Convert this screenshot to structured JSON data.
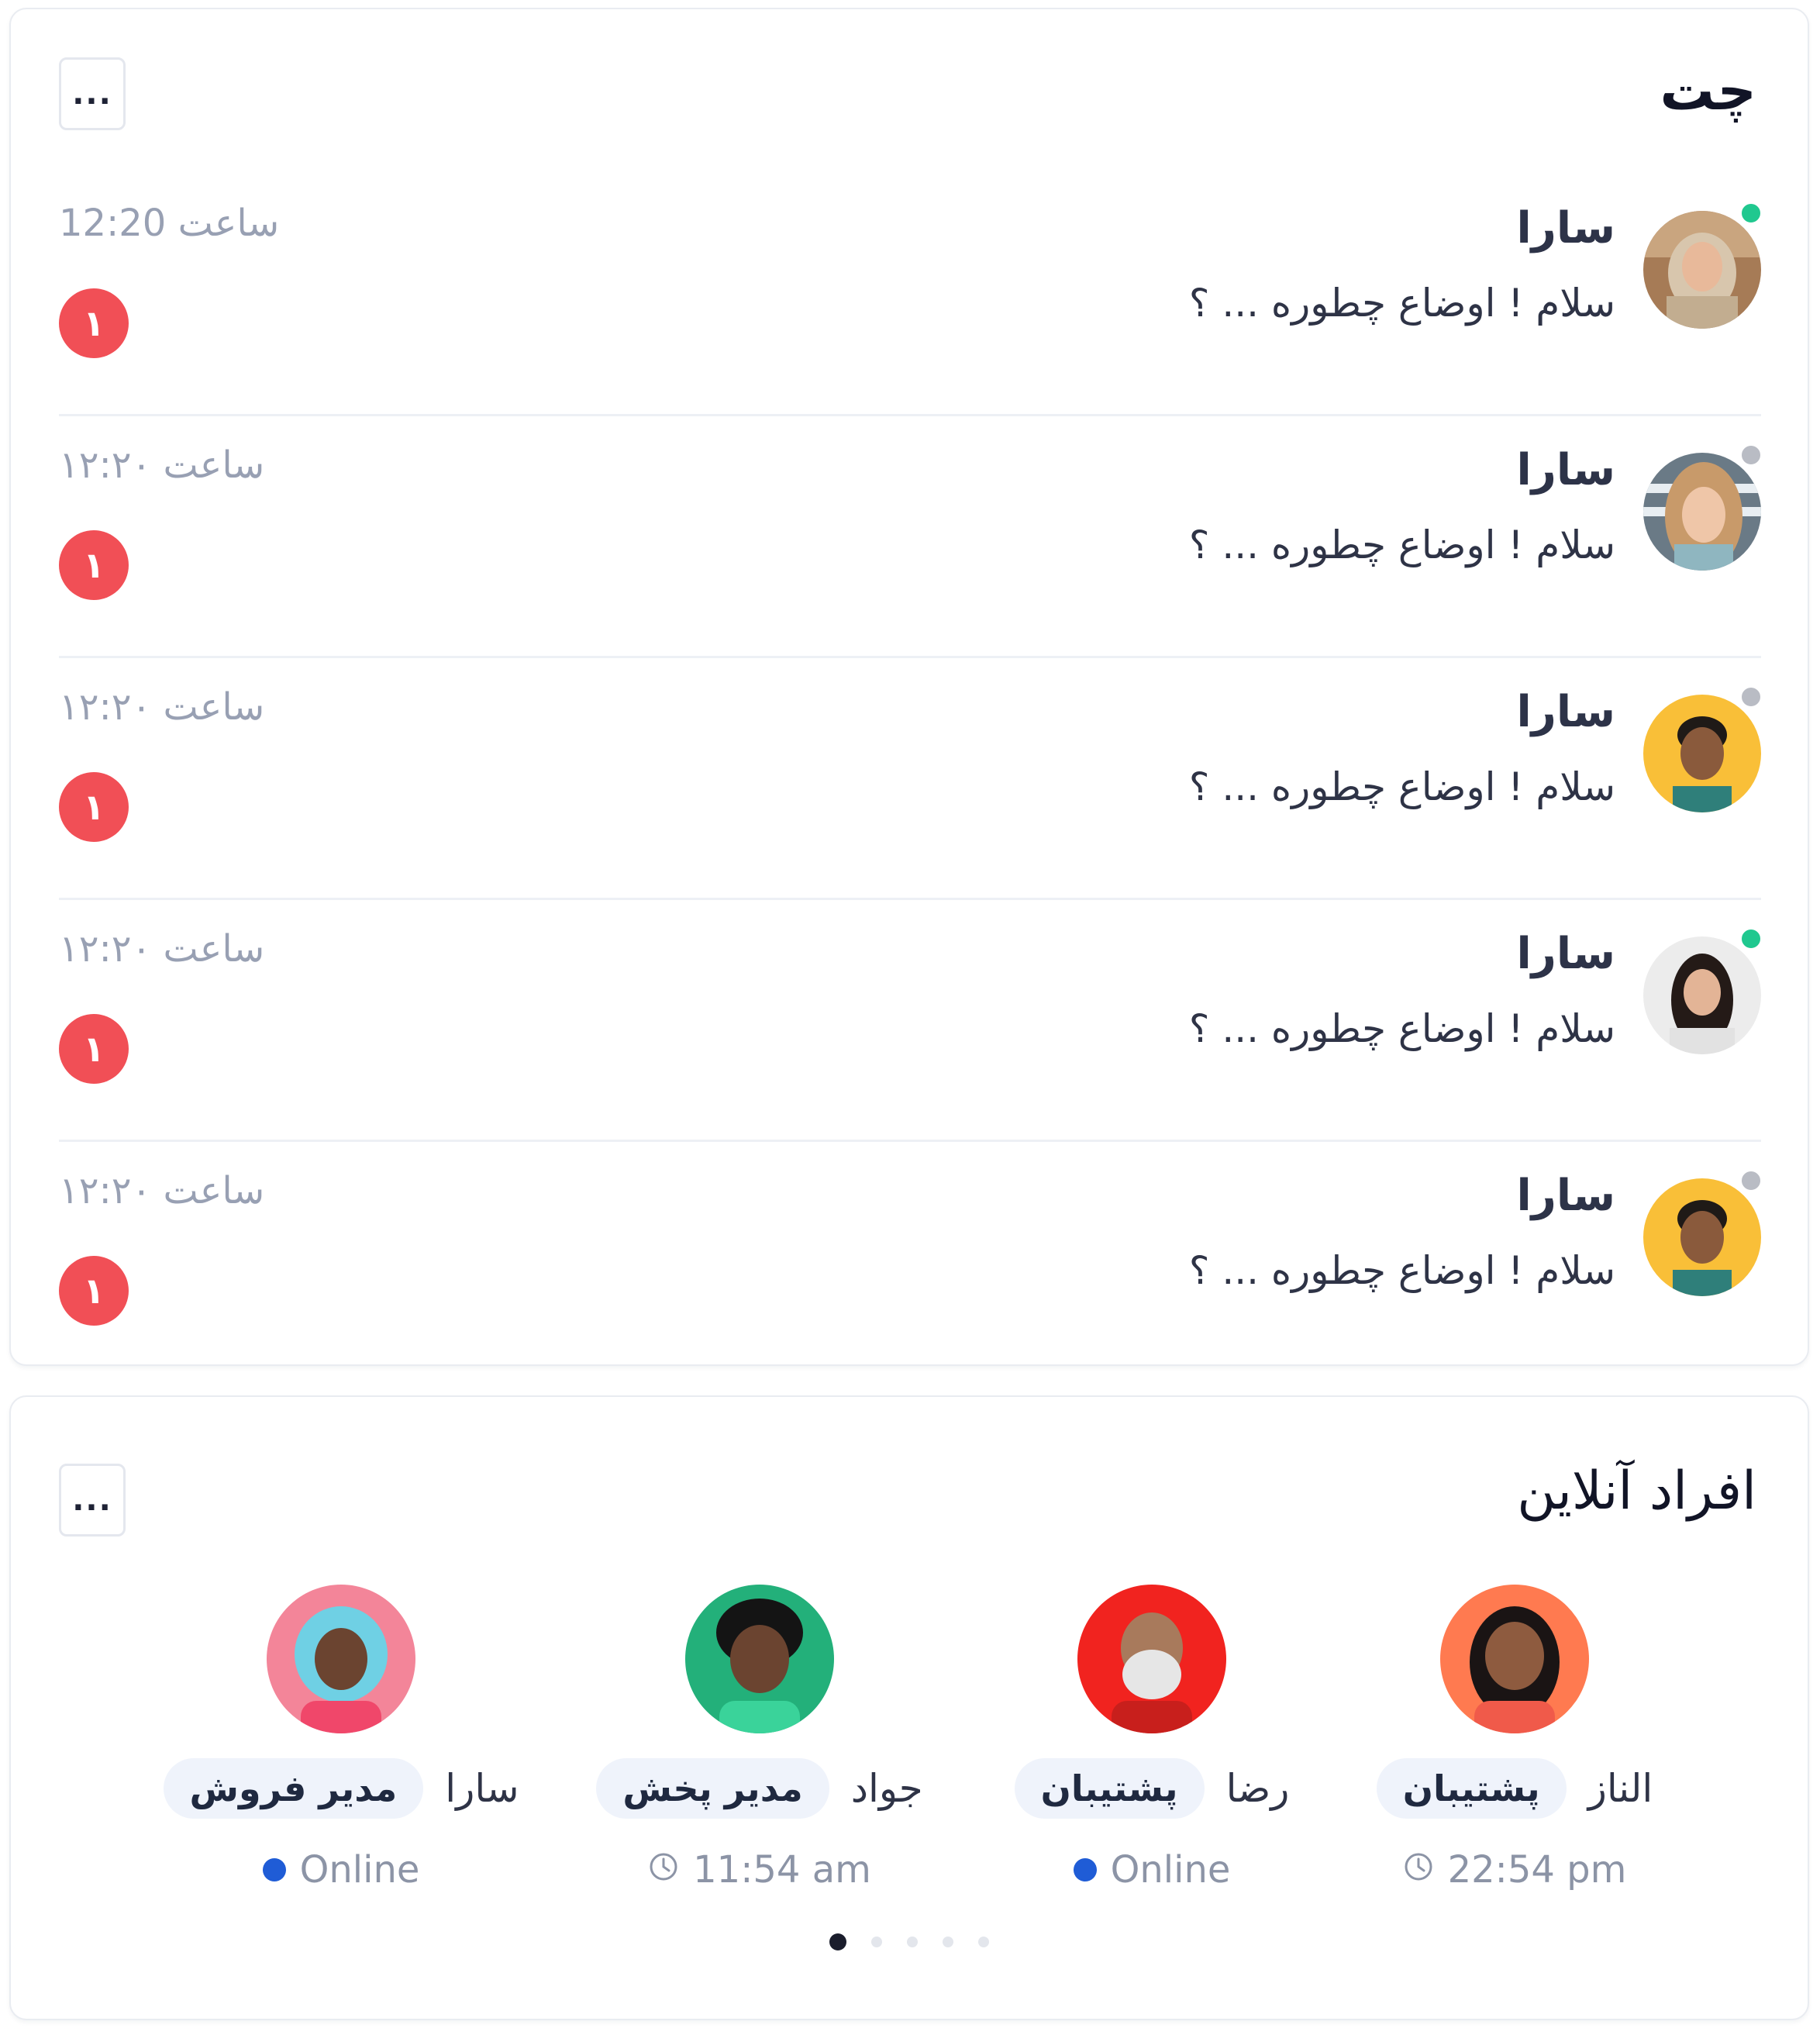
{
  "chat": {
    "title": "چت",
    "more_label": "...",
    "rows": [
      {
        "name": "سارا",
        "message": "سلام ! اوضاع چطوره ... ؟",
        "time": "ساعت 12:20",
        "unread": "۱",
        "status": "online",
        "avatar": "woman-hijab-photo"
      },
      {
        "name": "سارا",
        "message": "سلام ! اوضاع چطوره ... ؟",
        "time": "ساعت ۱۲:۲۰",
        "unread": "۱",
        "status": "offline",
        "avatar": "woman-blonde-photo"
      },
      {
        "name": "سارا",
        "message": "سلام ! اوضاع چطوره ... ؟",
        "time": "ساعت ۱۲:۲۰",
        "unread": "۱",
        "status": "offline",
        "avatar": "man-yellow-bg-photo"
      },
      {
        "name": "سارا",
        "message": "سلام ! اوضاع چطوره ... ؟",
        "time": "ساعت ۱۲:۲۰",
        "unread": "۱",
        "status": "online",
        "avatar": "woman-dark-hair-photo"
      },
      {
        "name": "سارا",
        "message": "سلام ! اوضاع چطوره ... ؟",
        "time": "ساعت ۱۲:۲۰",
        "unread": "۱",
        "status": "offline",
        "avatar": "man-yellow-bg-photo"
      }
    ]
  },
  "online": {
    "title": "افراد آنلاین",
    "more_label": "...",
    "people": [
      {
        "name": "الناز",
        "role": "پشتیبان",
        "status": "22:54 pm",
        "status_type": "time",
        "avatar": "girl-3d-avatar",
        "bg": "#ff7a50"
      },
      {
        "name": "رضا",
        "role": "پشتیبان",
        "status": "Online",
        "status_type": "online",
        "avatar": "old-man-3d-avatar",
        "bg": "#f1231f"
      },
      {
        "name": "جواد",
        "role": "مدیر پخش",
        "status": "11:54 am",
        "status_type": "time",
        "avatar": "boy-3d-avatar",
        "bg": "#23b07a"
      },
      {
        "name": "سارا",
        "role": "مدیر فروش",
        "status": "Online",
        "status_type": "online",
        "avatar": "curly-girl-3d-avatar",
        "bg": "#f38599"
      }
    ],
    "pages": 5,
    "active_page": 0
  },
  "colors": {
    "online": "#20c88f",
    "offline": "#b9bcc4",
    "unread": "#f14f56",
    "online_dot": "#1f5cd6"
  }
}
